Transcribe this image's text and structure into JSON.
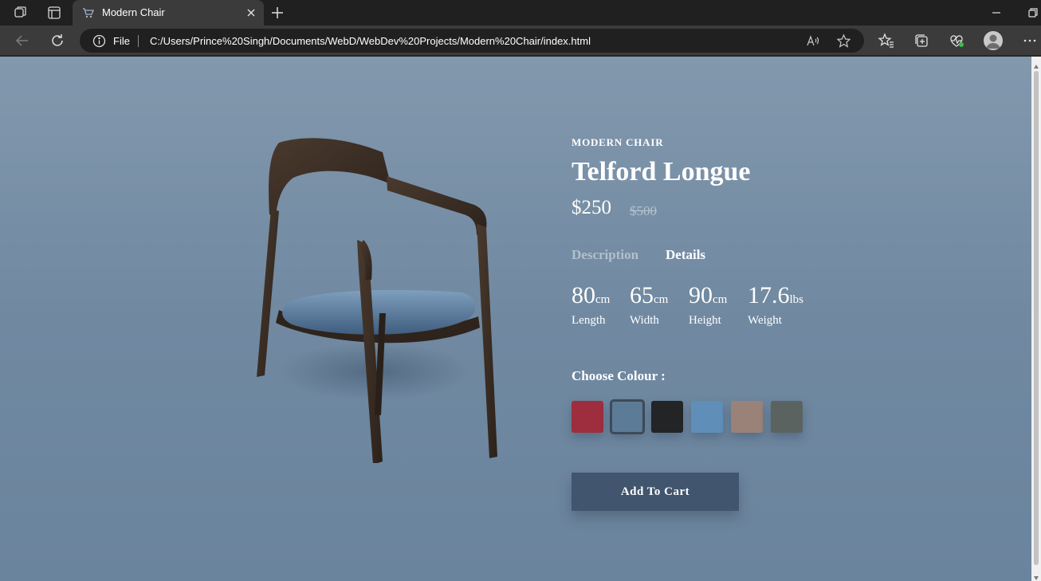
{
  "browser": {
    "tab": {
      "title": "Modern Chair"
    },
    "address": {
      "scheme_label": "File",
      "url": "C:/Users/Prince%20Singh/Documents/WebD/WebDev%20Projects/Modern%20Chair/index.html"
    }
  },
  "product": {
    "category": "MODERN CHAIR",
    "title": "Telford Longue",
    "price": "$250",
    "old_price": "$500",
    "tabs": [
      {
        "label": "Description",
        "active": false
      },
      {
        "label": "Details",
        "active": true
      }
    ],
    "specs": [
      {
        "value": "80",
        "unit": "cm",
        "label": "Length"
      },
      {
        "value": "65",
        "unit": "cm",
        "label": "Width"
      },
      {
        "value": "90",
        "unit": "cm",
        "label": "Height"
      },
      {
        "value": "17.6",
        "unit": "lbs",
        "label": "Weight"
      }
    ],
    "colour_label": "Choose Colour :",
    "colours": [
      {
        "name": "red",
        "color": "#9e2d3d",
        "selected": false
      },
      {
        "name": "blue-velvet",
        "color": "#5c7b96",
        "selected": true
      },
      {
        "name": "black",
        "color": "#222426",
        "selected": false
      },
      {
        "name": "light-blue",
        "color": "#5f8fb8",
        "selected": false
      },
      {
        "name": "tan",
        "color": "#9a8278",
        "selected": false
      },
      {
        "name": "grey",
        "color": "#5b6361",
        "selected": false
      }
    ],
    "cart_label": "Add To Cart"
  },
  "theme": {
    "page_background": "#7a91a8",
    "button_color": "#42556e",
    "accent_text": "#ffffff"
  }
}
